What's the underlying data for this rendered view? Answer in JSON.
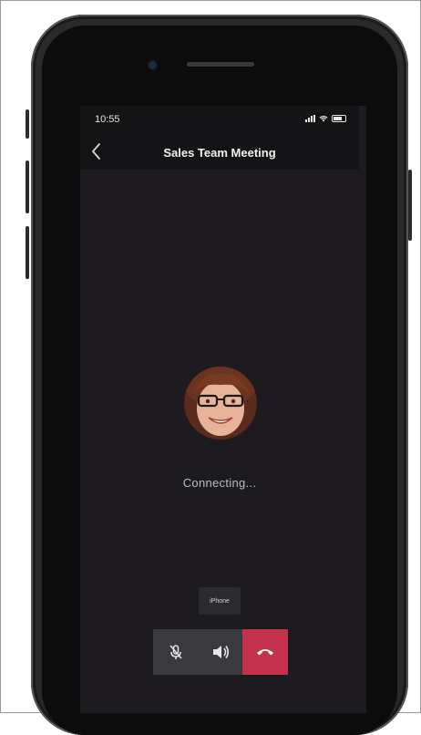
{
  "status_bar": {
    "time": "10:55"
  },
  "header": {
    "title": "Sales Team Meeting"
  },
  "call": {
    "status_text": "Connecting...",
    "audio_device_label": "iPhone"
  },
  "controls": {
    "mute_icon": "microphone-muted-icon",
    "speaker_icon": "speaker-icon",
    "end_call_icon": "end-call-icon"
  },
  "colors": {
    "end_call": "#c4314b",
    "screen_bg": "#1d1b1f"
  }
}
